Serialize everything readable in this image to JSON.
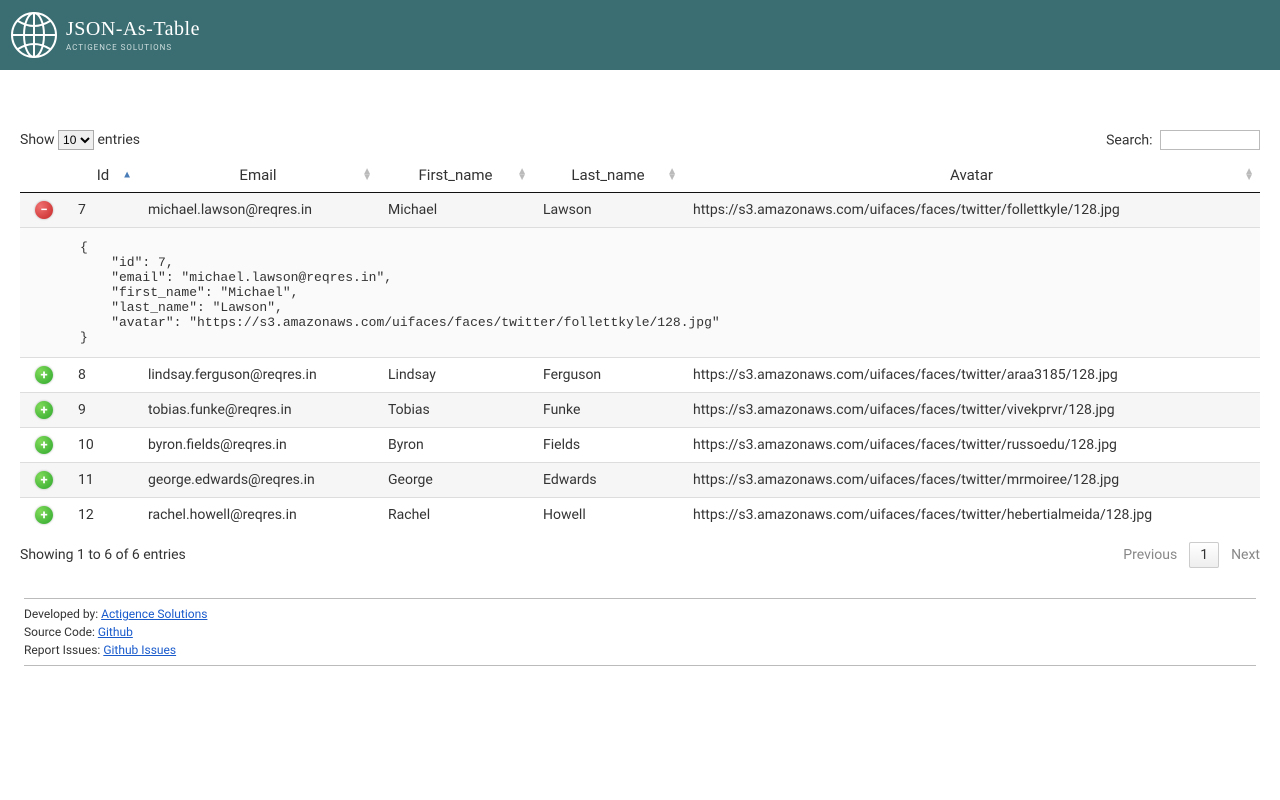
{
  "header": {
    "title": "JSON-As-Table",
    "subtitle": "ACTIGENCE SOLUTIONS"
  },
  "controls": {
    "show_label": "Show",
    "entries_label": "entries",
    "page_size": "10",
    "search_label": "Search:",
    "search_value": ""
  },
  "table": {
    "columns": [
      "Id",
      "Email",
      "First_name",
      "Last_name",
      "Avatar"
    ],
    "rows": [
      {
        "id": "7",
        "email": "michael.lawson@reqres.in",
        "first_name": "Michael",
        "last_name": "Lawson",
        "avatar": "https://s3.amazonaws.com/uifaces/faces/twitter/follettkyle/128.jpg",
        "expanded": true
      },
      {
        "id": "8",
        "email": "lindsay.ferguson@reqres.in",
        "first_name": "Lindsay",
        "last_name": "Ferguson",
        "avatar": "https://s3.amazonaws.com/uifaces/faces/twitter/araa3185/128.jpg",
        "expanded": false
      },
      {
        "id": "9",
        "email": "tobias.funke@reqres.in",
        "first_name": "Tobias",
        "last_name": "Funke",
        "avatar": "https://s3.amazonaws.com/uifaces/faces/twitter/vivekprvr/128.jpg",
        "expanded": false
      },
      {
        "id": "10",
        "email": "byron.fields@reqres.in",
        "first_name": "Byron",
        "last_name": "Fields",
        "avatar": "https://s3.amazonaws.com/uifaces/faces/twitter/russoedu/128.jpg",
        "expanded": false
      },
      {
        "id": "11",
        "email": "george.edwards@reqres.in",
        "first_name": "George",
        "last_name": "Edwards",
        "avatar": "https://s3.amazonaws.com/uifaces/faces/twitter/mrmoiree/128.jpg",
        "expanded": false
      },
      {
        "id": "12",
        "email": "rachel.howell@reqres.in",
        "first_name": "Rachel",
        "last_name": "Howell",
        "avatar": "https://s3.amazonaws.com/uifaces/faces/twitter/hebertialmeida/128.jpg",
        "expanded": false
      }
    ],
    "expanded_detail": "{\n    \"id\": 7,\n    \"email\": \"michael.lawson@reqres.in\",\n    \"first_name\": \"Michael\",\n    \"last_name\": \"Lawson\",\n    \"avatar\": \"https://s3.amazonaws.com/uifaces/faces/twitter/follettkyle/128.jpg\"\n}"
  },
  "info_text": "Showing 1 to 6 of 6 entries",
  "pagination": {
    "previous": "Previous",
    "next": "Next",
    "page": "1"
  },
  "credits": {
    "dev_label": "Developed by: ",
    "dev_link": "Actigence Solutions",
    "src_label": "Source Code: ",
    "src_link": "Github",
    "issues_label": "Report Issues: ",
    "issues_link": "Github Issues"
  }
}
